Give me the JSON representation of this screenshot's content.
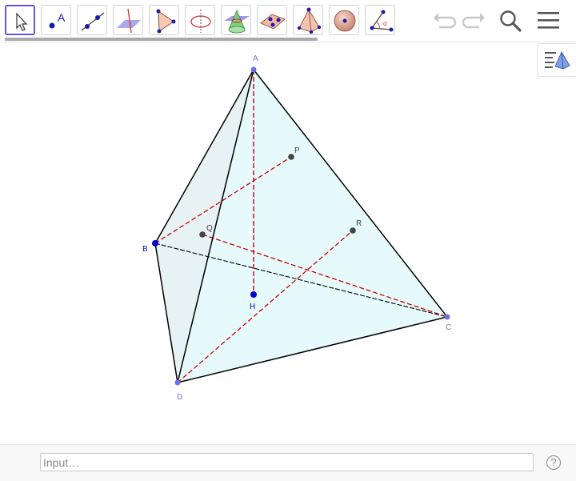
{
  "toolbar": {
    "tools": [
      {
        "name": "move-tool-icon",
        "selected": true
      },
      {
        "name": "point-tool-icon",
        "glyph": "A"
      },
      {
        "name": "line-tool-icon"
      },
      {
        "name": "perpendicular-line-tool-icon"
      },
      {
        "name": "polygon-tool-icon"
      },
      {
        "name": "circle-axis-tool-icon"
      },
      {
        "name": "intersect-surfaces-tool-icon"
      },
      {
        "name": "plane-through-points-tool-icon"
      },
      {
        "name": "pyramid-tool-icon"
      },
      {
        "name": "sphere-tool-icon"
      },
      {
        "name": "angle-tool-icon",
        "glyph": "α"
      }
    ],
    "actions": [
      "undo-icon",
      "redo-icon",
      "search-icon",
      "menu-icon"
    ]
  },
  "colors": {
    "accent": "#6557d2",
    "face_fill": "#e6f9fb",
    "edge": "#000000",
    "dashed": "#cc0000",
    "vertex": "#6b72e3",
    "point_dark": "#444444",
    "point_blue": "#0000cc"
  },
  "graphics": {
    "labels": {
      "A": "A",
      "B": "B",
      "C": "C",
      "D": "D",
      "H": "H",
      "P": "P",
      "Q": "Q",
      "R": "R"
    }
  },
  "input": {
    "placeholder": "Input…",
    "value": ""
  },
  "help": {
    "label": "?"
  }
}
